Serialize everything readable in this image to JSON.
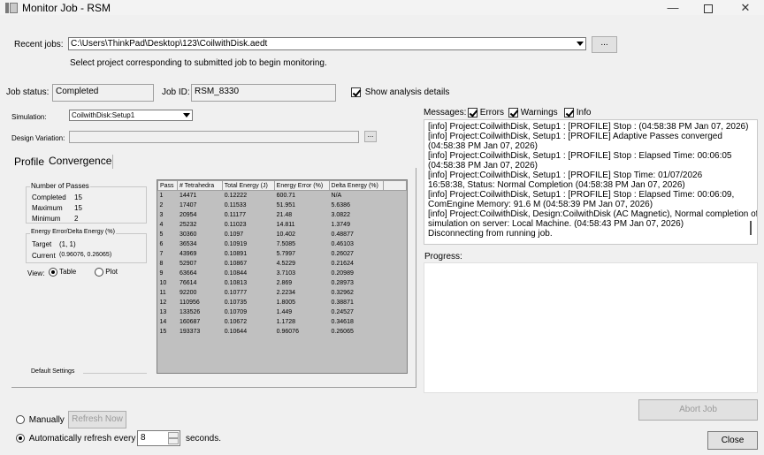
{
  "window": {
    "title": "Monitor Job - RSM",
    "minimize_glyph": "—",
    "close_glyph": "✕"
  },
  "recent_jobs": {
    "label": "Recent jobs:",
    "value": "C:\\Users\\ThinkPad\\Desktop\\123\\CoilwithDisk.aedt",
    "browse_label": "...",
    "hint": "Select project corresponding to submitted job to begin monitoring."
  },
  "job": {
    "status_label": "Job status:",
    "status_value": "Completed",
    "id_label": "Job ID:",
    "id_value": "RSM_8330",
    "show_details_label": "Show analysis details",
    "show_details_checked": true
  },
  "simulation": {
    "label": "Simulation:",
    "value": "CoilwithDisk:Setup1",
    "design_variation_label": "Design Variation:",
    "design_variation_value": "",
    "design_variation_button": "..."
  },
  "tabs": [
    {
      "label": "Profile",
      "active": false
    },
    {
      "label": "Convergence",
      "active": true
    }
  ],
  "passes_group": {
    "title": "Number of Passes",
    "rows": [
      {
        "label": "Completed",
        "value": "15"
      },
      {
        "label": "Maximum",
        "value": "15"
      },
      {
        "label": "Minimum",
        "value": "2"
      }
    ]
  },
  "energy_group": {
    "title": "Energy Error/Delta Energy (%)",
    "rows": [
      {
        "label": "Target",
        "value": "(1, 1)"
      },
      {
        "label": "Current",
        "value": "(0.96076, 0.26065)"
      }
    ]
  },
  "view": {
    "label": "View:",
    "options": [
      {
        "label": "Table",
        "selected": true
      },
      {
        "label": "Plot",
        "selected": false
      }
    ]
  },
  "default_settings_label": "Default Settings",
  "convergence_table": {
    "columns": [
      "Pass",
      "# Tetrahedra",
      "Total Energy (J)",
      "Energy Error (%)",
      "Delta Energy (%)"
    ],
    "rows": [
      [
        "1",
        "14471",
        "0.12222",
        "600.71",
        "N/A"
      ],
      [
        "2",
        "17407",
        "0.11533",
        "51.951",
        "5.6386"
      ],
      [
        "3",
        "20954",
        "0.11177",
        "21.48",
        "3.0822"
      ],
      [
        "4",
        "25232",
        "0.11023",
        "14.811",
        "1.3749"
      ],
      [
        "5",
        "30360",
        "0.1097",
        "10.402",
        "0.48877"
      ],
      [
        "6",
        "36534",
        "0.10919",
        "7.5085",
        "0.46103"
      ],
      [
        "7",
        "43969",
        "0.10891",
        "5.7997",
        "0.26027"
      ],
      [
        "8",
        "52907",
        "0.10867",
        "4.5229",
        "0.21624"
      ],
      [
        "9",
        "63664",
        "0.10844",
        "3.7103",
        "0.20989"
      ],
      [
        "10",
        "76614",
        "0.10813",
        "2.869",
        "0.28973"
      ],
      [
        "11",
        "92200",
        "0.10777",
        "2.2234",
        "0.32962"
      ],
      [
        "12",
        "110956",
        "0.10735",
        "1.8005",
        "0.38871"
      ],
      [
        "13",
        "133526",
        "0.10709",
        "1.449",
        "0.24527"
      ],
      [
        "14",
        "160687",
        "0.10672",
        "1.1728",
        "0.34618"
      ],
      [
        "15",
        "193373",
        "0.10644",
        "0.96076",
        "0.26065"
      ]
    ]
  },
  "messages": {
    "label": "Messages:",
    "filters": [
      {
        "label": "Errors",
        "checked": true
      },
      {
        "label": "Warnings",
        "checked": true
      },
      {
        "label": "Info",
        "checked": true
      }
    ],
    "lines": [
      "[info] Project:CoilwithDisk, Setup1 : [PROFILE] Stop :    (04:58:38 PM  Jan 07, 2026)",
      "[info] Project:CoilwithDisk, Setup1 : [PROFILE]       Adaptive Passes converged",
      "(04:58:38 PM  Jan 07, 2026)",
      "[info] Project:CoilwithDisk, Setup1 : [PROFILE] Stop : Elapsed Time: 00:06:05",
      "(04:58:38 PM  Jan 07, 2026)",
      "[info] Project:CoilwithDisk, Setup1 : [PROFILE]       Stop Time: 01/07/2026",
      "16:58:38, Status: Normal Completion (04:58:38 PM  Jan 07, 2026)",
      "[info] Project:CoilwithDisk, Setup1 : [PROFILE] Stop : Elapsed Time: 00:06:09,",
      "ComEngine Memory: 91.6 M (04:58:39 PM  Jan 07, 2026)",
      "[info] Project:CoilwithDisk, Design:CoilwithDisk (AC Magnetic), Normal completion of",
      "simulation on server: Local Machine. (04:58:43 PM  Jan 07, 2026)",
      "Disconnecting from running job."
    ]
  },
  "progress": {
    "label": "Progress:"
  },
  "refresh": {
    "manual_label": "Manually",
    "manual_selected": false,
    "refresh_now_label": "Refresh Now",
    "auto_label": "Automatically refresh every",
    "auto_selected": true,
    "interval_value": "8",
    "seconds_label": "seconds."
  },
  "buttons": {
    "abort_label": "Abort Job",
    "close_label": "Close"
  }
}
